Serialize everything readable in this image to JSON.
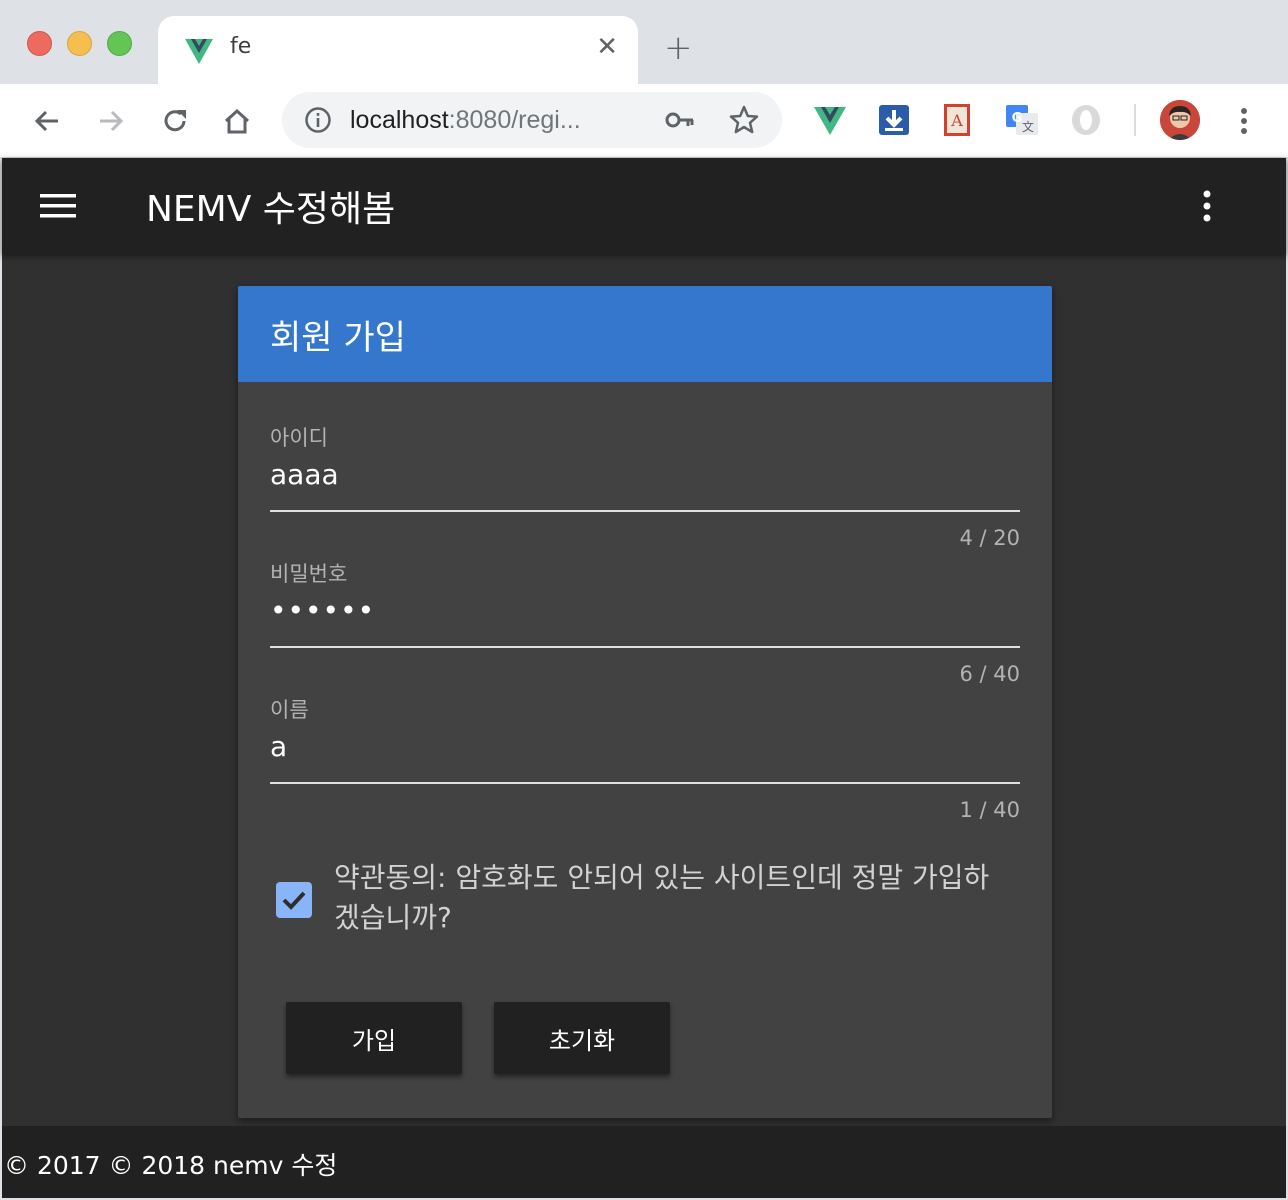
{
  "browser": {
    "tab_title": "fe",
    "tab_close": "✕",
    "new_tab": "+",
    "url_host": "localhost",
    "url_rest": ":8080/regi...",
    "extension_icons": [
      "vue-devtools-icon",
      "download-icon",
      "pdf-icon",
      "translate-icon",
      "opera-icon"
    ]
  },
  "app": {
    "title": "NEMV 수정해봄"
  },
  "card": {
    "title": "회원 가입",
    "fields": [
      {
        "label": "아이디",
        "value": "aaaa",
        "counter": "4 / 20"
      },
      {
        "label": "비밀번호",
        "value": "••••••",
        "counter": "6 / 40"
      },
      {
        "label": "이름",
        "value": "a",
        "counter": "1 / 40"
      }
    ],
    "agree_label": "약관동의: 암호화도 안되어 있는 사이트인데 정말 가입하겠습니까?",
    "agree_checked": true,
    "submit_label": "가입",
    "reset_label": "초기화"
  },
  "footer": {
    "text": "© 2017 © 2018 nemv 수정"
  },
  "colors": {
    "header_blue": "#3477cc",
    "appbar": "#212121",
    "background": "#303030",
    "card": "#424242",
    "checkbox": "#8ab4f8"
  }
}
